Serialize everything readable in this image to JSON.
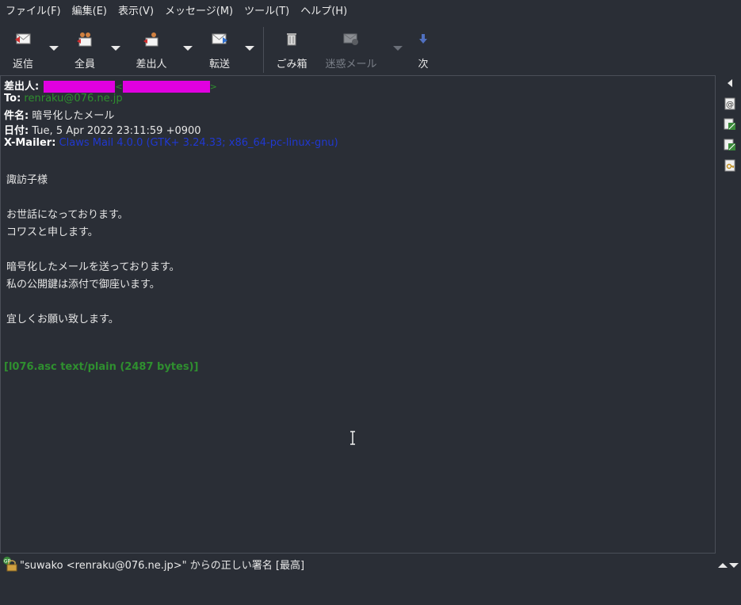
{
  "menubar": {
    "items": [
      "ファイル(F)",
      "編集(E)",
      "表示(V)",
      "メッセージ(M)",
      "ツール(T)",
      "ヘルプ(H)"
    ]
  },
  "toolbar": {
    "reply": "返信",
    "reply_all": "全員",
    "reply_sender": "差出人",
    "forward": "転送",
    "trash": "ごみ箱",
    "spam": "迷惑メール",
    "next": "次"
  },
  "headers": {
    "from_label": "差出人:",
    "to_label": "To:",
    "to_value": "renraku@076.ne.jp",
    "subject_label": "件名:",
    "subject_value": "暗号化したメール",
    "date_label": "日付:",
    "date_value": "Tue, 5 Apr 2022 23:11:59 +0900",
    "xmailer_label": "X-Mailer:",
    "xmailer_value": "Claws Mail 4.0.0 (GTK+ 3.24.33; x86_64-pc-linux-gnu)"
  },
  "body": {
    "line1": "諏訪子様",
    "line2": "お世話になっております。",
    "line3": "コワスと申します。",
    "line4": "暗号化したメールを送っております。",
    "line5": "私の公開鍵は添付で御座います。",
    "line6": "宜しくお願い致します。",
    "attachment": "[l076.asc  text/plain (2487 bytes)]"
  },
  "status": {
    "text": "\"suwako <renraku@076.ne.jp>\" からの正しい署名 [最高]"
  },
  "colors": {
    "background": "#2a2e36",
    "redaction": "#e000e0",
    "header_green": "#2f8f2f",
    "header_blue": "#2038d0"
  }
}
